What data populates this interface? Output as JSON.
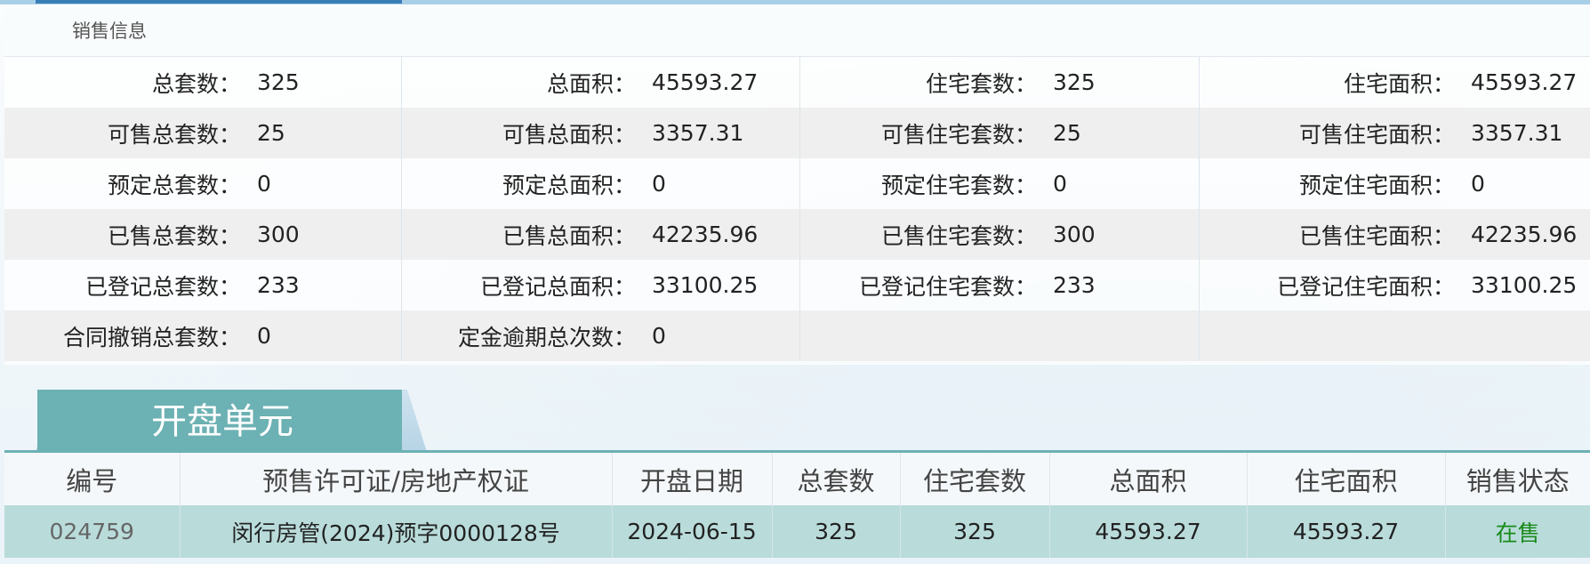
{
  "sales_info": {
    "title": "销售信息",
    "rows": [
      [
        [
          "总套数：",
          "325"
        ],
        [
          "总面积：",
          "45593.27"
        ],
        [
          "住宅套数：",
          "325"
        ],
        [
          "住宅面积：",
          "45593.27"
        ]
      ],
      [
        [
          "可售总套数：",
          "25"
        ],
        [
          "可售总面积：",
          "3357.31"
        ],
        [
          "可售住宅套数：",
          "25"
        ],
        [
          "可售住宅面积：",
          "3357.31"
        ]
      ],
      [
        [
          "预定总套数：",
          "0"
        ],
        [
          "预定总面积：",
          "0"
        ],
        [
          "预定住宅套数：",
          "0"
        ],
        [
          "预定住宅面积：",
          "0"
        ]
      ],
      [
        [
          "已售总套数：",
          "300"
        ],
        [
          "已售总面积：",
          "42235.96"
        ],
        [
          "已售住宅套数：",
          "300"
        ],
        [
          "已售住宅面积：",
          "42235.96"
        ]
      ],
      [
        [
          "已登记总套数：",
          "233"
        ],
        [
          "已登记总面积：",
          "33100.25"
        ],
        [
          "已登记住宅套数：",
          "233"
        ],
        [
          "已登记住宅面积：",
          "33100.25"
        ]
      ],
      [
        [
          "合同撤销总套数：",
          "0"
        ],
        [
          "定金逾期总次数：",
          "0"
        ],
        [
          "",
          ""
        ],
        [
          "",
          ""
        ]
      ]
    ]
  },
  "units": {
    "title": "开盘单元",
    "headers": [
      "编号",
      "预售许可证/房地产权证",
      "开盘日期",
      "总套数",
      "住宅套数",
      "总面积",
      "住宅面积",
      "销售状态"
    ],
    "rows": [
      [
        "024759",
        "闵行房管(2024)预字0000128号",
        "2024-06-15",
        "325",
        "325",
        "45593.27",
        "45593.27",
        "在售"
      ]
    ]
  }
}
